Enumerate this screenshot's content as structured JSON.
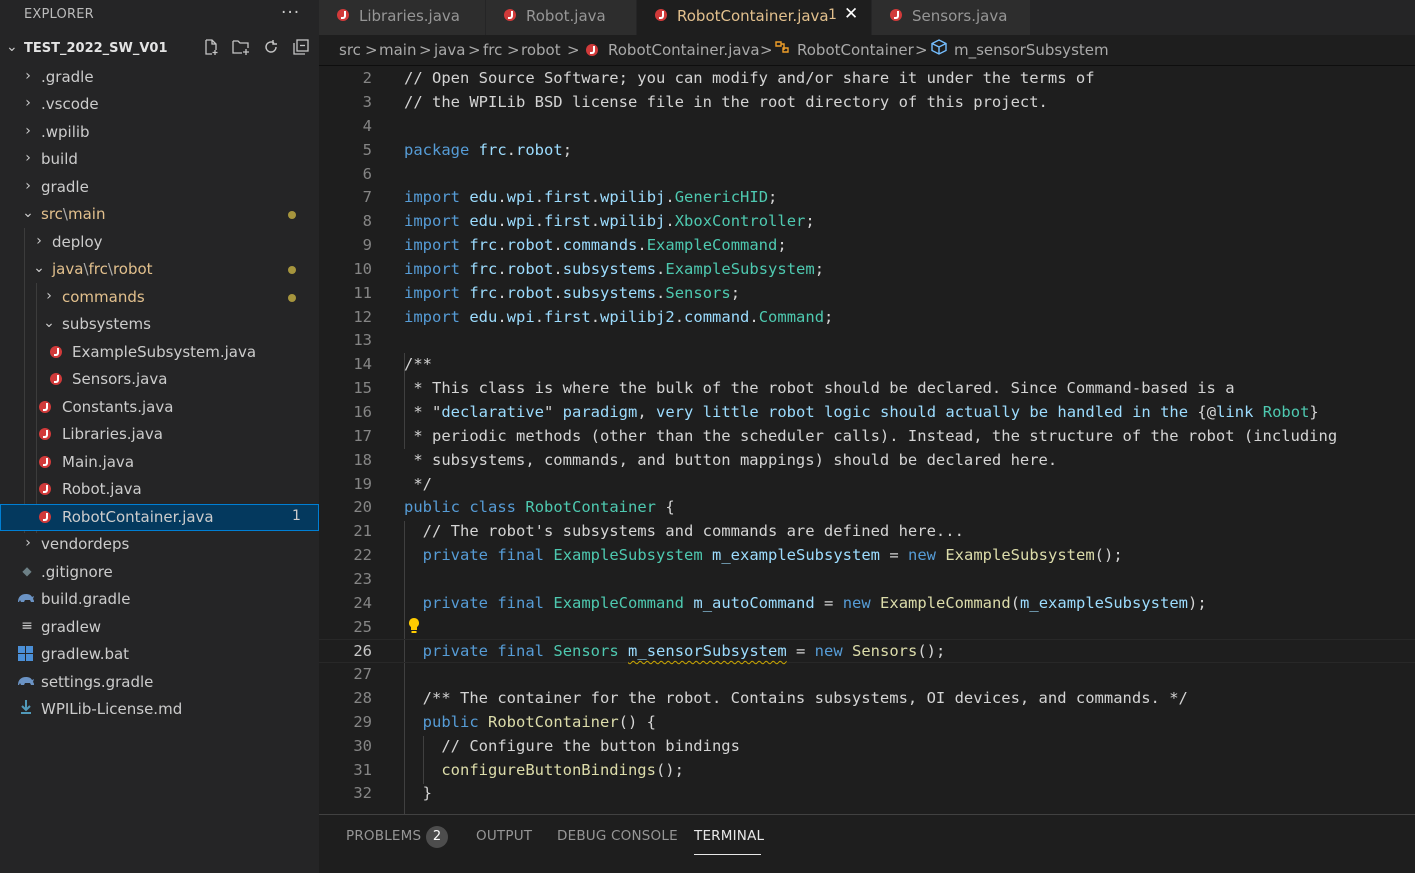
{
  "explorer": {
    "title": "EXPLORER",
    "more": "···",
    "folder": "TEST_2022_SW_V01"
  },
  "tree": [
    {
      "label": ".gradle"
    },
    {
      "label": ".vscode"
    },
    {
      "label": ".wpilib"
    },
    {
      "label": "build"
    },
    {
      "label": "gradle"
    },
    {
      "p1": "src",
      "sep": "\\",
      "p2": "main"
    },
    {
      "label": "deploy"
    },
    {
      "p1": "java",
      "sep1": "\\",
      "p2": "frc",
      "sep2": "\\",
      "p3": "robot"
    },
    {
      "label": "commands"
    },
    {
      "label": "subsystems"
    },
    {
      "label": "ExampleSubsystem.java"
    },
    {
      "label": "Sensors.java"
    },
    {
      "label": "Constants.java"
    },
    {
      "label": "Libraries.java"
    },
    {
      "label": "Main.java"
    },
    {
      "label": "Robot.java"
    },
    {
      "label": "RobotContainer.java",
      "badge": "1"
    },
    {
      "label": "vendordeps"
    },
    {
      "label": ".gitignore"
    },
    {
      "label": "build.gradle"
    },
    {
      "label": "gradlew"
    },
    {
      "label": "gradlew.bat"
    },
    {
      "label": "settings.gradle"
    },
    {
      "label": "WPILib-License.md"
    }
  ],
  "tabs": [
    {
      "label": "Libraries.java"
    },
    {
      "label": "Robot.java"
    },
    {
      "label": "RobotContainer.java",
      "modified": "1",
      "close": "✕"
    },
    {
      "label": "Sensors.java"
    }
  ],
  "breadcrumb": {
    "items": [
      "src",
      "main",
      "java",
      "frc",
      "robot"
    ],
    "file": "RobotContainer.java",
    "cls": "RobotContainer",
    "field": "m_sensorSubsystem",
    "sep": ">"
  },
  "code": [
    {
      "n": "2",
      "t": "// Open Source Software; you can modify and/or share it under the terms of"
    },
    {
      "n": "3",
      "t": "// the WPILib BSD license file in the root directory of this project."
    },
    {
      "n": "4",
      "t": ""
    },
    {
      "n": "5",
      "t": "package frc.robot;"
    },
    {
      "n": "6",
      "t": ""
    },
    {
      "n": "7",
      "t": "import edu.wpi.first.wpilibj.GenericHID;"
    },
    {
      "n": "8",
      "t": "import edu.wpi.first.wpilibj.XboxController;"
    },
    {
      "n": "9",
      "t": "import frc.robot.commands.ExampleCommand;"
    },
    {
      "n": "10",
      "t": "import frc.robot.subsystems.ExampleSubsystem;"
    },
    {
      "n": "11",
      "t": "import frc.robot.subsystems.Sensors;"
    },
    {
      "n": "12",
      "t": "import edu.wpi.first.wpilibj2.command.Command;"
    },
    {
      "n": "13",
      "t": ""
    },
    {
      "n": "14",
      "t": "/**"
    },
    {
      "n": "15",
      "t": " * This class is where the bulk of the robot should be declared. Since Command-based is a"
    },
    {
      "n": "16",
      "t": " * \"declarative\" paradigm, very little robot logic should actually be handled in the {@link Robot}"
    },
    {
      "n": "17",
      "t": " * periodic methods (other than the scheduler calls). Instead, the structure of the robot (including"
    },
    {
      "n": "18",
      "t": " * subsystems, commands, and button mappings) should be declared here."
    },
    {
      "n": "19",
      "t": " */"
    },
    {
      "n": "20",
      "t": "public class RobotContainer {"
    },
    {
      "n": "21",
      "t": "  // The robot's subsystems and commands are defined here..."
    },
    {
      "n": "22",
      "t": "  private final ExampleSubsystem m_exampleSubsystem = new ExampleSubsystem();"
    },
    {
      "n": "23",
      "t": ""
    },
    {
      "n": "24",
      "t": "  private final ExampleCommand m_autoCommand = new ExampleCommand(m_exampleSubsystem);"
    },
    {
      "n": "25",
      "t": ""
    },
    {
      "n": "26",
      "t": "  private final Sensors m_sensorSubsystem = new Sensors();"
    },
    {
      "n": "27",
      "t": ""
    },
    {
      "n": "28",
      "t": "  /** The container for the robot. Contains subsystems, OI devices, and commands. */"
    },
    {
      "n": "29",
      "t": "  public RobotContainer() {"
    },
    {
      "n": "30",
      "t": "    // Configure the button bindings"
    },
    {
      "n": "31",
      "t": "    configureButtonBindings();"
    },
    {
      "n": "32",
      "t": "  }"
    }
  ],
  "panel": {
    "tabs": [
      "PROBLEMS",
      "OUTPUT",
      "DEBUG CONSOLE",
      "TERMINAL"
    ],
    "problems_count": "2"
  },
  "colors": {
    "accent": "#007fd4",
    "modified": "#e2c08d",
    "java_icon": "#d13a3a"
  }
}
